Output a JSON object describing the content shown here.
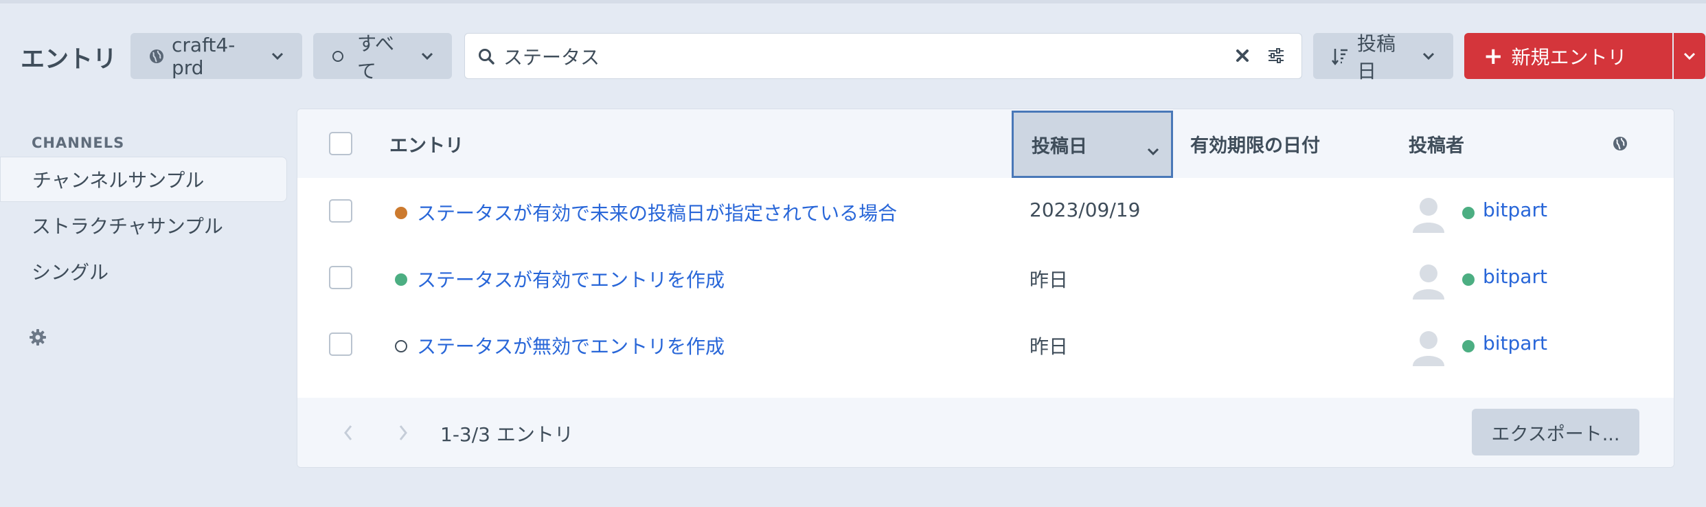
{
  "header": {
    "title": "エントリ",
    "site_label": "craft4-prd",
    "status_label": "すべて",
    "search": {
      "value": "ステータス",
      "placeholder": ""
    },
    "sort_label": "投稿日",
    "new_entry_label": "新規エントリ"
  },
  "sidebar": {
    "heading": "CHANNELS",
    "items": [
      {
        "label": "チャンネルサンプル",
        "active": true
      },
      {
        "label": "ストラクチャサンプル",
        "active": false
      },
      {
        "label": "シングル",
        "active": false
      }
    ]
  },
  "table": {
    "columns": {
      "entry": "エントリ",
      "post_date": "投稿日",
      "expiry_date": "有効期限の日付",
      "author": "投稿者"
    },
    "rows": [
      {
        "status": "pending",
        "status_color": "#cc7a2e",
        "title": "ステータスが有効で未来の投稿日が指定されている場合",
        "post_date": "2023/09/19",
        "expiry_date": "",
        "author": "bitpart"
      },
      {
        "status": "live",
        "status_color": "#4cae82",
        "title": "ステータスが有効でエントリを作成",
        "post_date": "昨日",
        "expiry_date": "",
        "author": "bitpart"
      },
      {
        "status": "disabled",
        "status_color": "",
        "title": "ステータスが無効でエントリを作成",
        "post_date": "昨日",
        "expiry_date": "",
        "author": "bitpart"
      }
    ],
    "footer": {
      "pagination_text": "1-3/3 エントリ",
      "export_label": "エクスポート..."
    }
  },
  "colors": {
    "accent": "#d4353b",
    "link": "#2866d8",
    "author_status": "#4cae82",
    "background": "#e4eaf3"
  },
  "icons": [
    "globe-icon",
    "circle-icon",
    "chevron-down-icon",
    "search-icon",
    "clear-icon",
    "adjust-icon",
    "sort-icon",
    "plus-icon",
    "gear-icon",
    "avatar-icon",
    "chevron-left-icon",
    "chevron-right-icon"
  ]
}
